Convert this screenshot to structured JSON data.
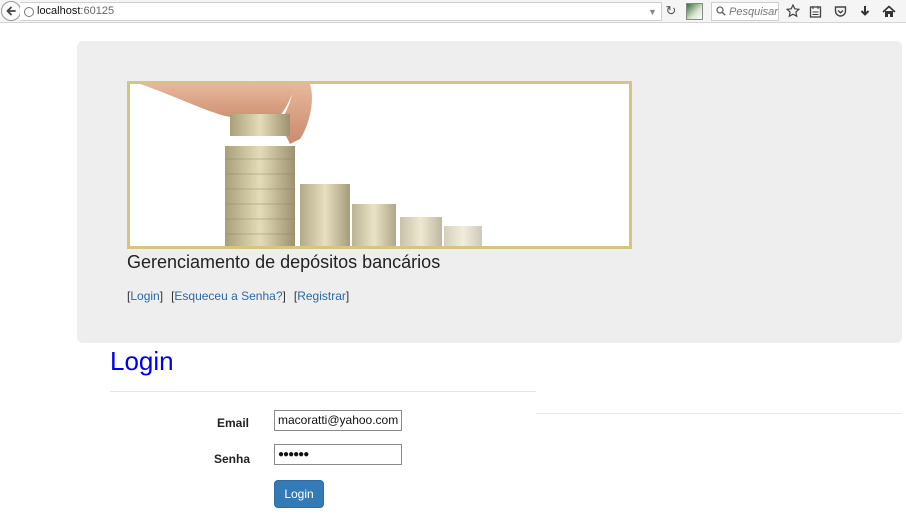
{
  "browser": {
    "url_host": "localhost",
    "url_port": ":60125",
    "search_placeholder": "Pesquisar"
  },
  "header": {
    "site_title": "Gerenciamento de depósitos bancários",
    "links": [
      {
        "label": "Login"
      },
      {
        "label": "Esqueceu a Senha?"
      },
      {
        "label": "Registrar"
      }
    ]
  },
  "login_form": {
    "heading": "Login",
    "email_label": "Email",
    "email_value": "macoratti@yahoo.com",
    "password_label": "Senha",
    "password_value": "●●●●●●",
    "submit_label": "Login"
  },
  "colors": {
    "link": "#2a6aa8",
    "heading": "#0000ee",
    "button": "#337ab7",
    "jumbotron_bg": "#eeeeee",
    "banner_border": "#d5c483"
  }
}
